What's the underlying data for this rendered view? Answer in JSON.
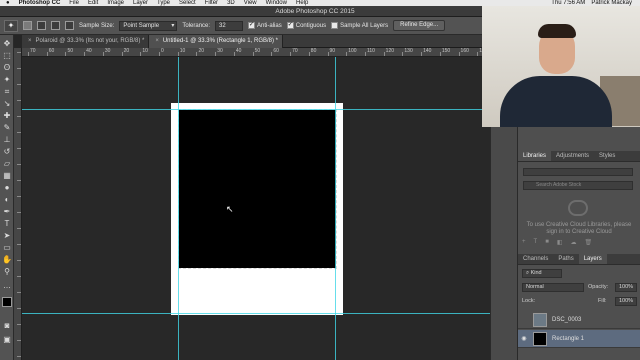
{
  "menubar": {
    "apple": "",
    "app": "Photoshop CC",
    "items": [
      "File",
      "Edit",
      "Image",
      "Layer",
      "Type",
      "Select",
      "Filter",
      "3D",
      "View",
      "Window",
      "Help"
    ],
    "clock": "Thu 7:56 AM",
    "user": "Patrick Mackay"
  },
  "window": {
    "title": "Adobe Photoshop CC 2015"
  },
  "options": {
    "sample_size_label": "Sample Size:",
    "sample_size_value": "Point Sample",
    "tolerance_label": "Tolerance:",
    "tolerance_value": "32",
    "anti_alias": "Anti-alias",
    "contiguous": "Contiguous",
    "sample_all_layers": "Sample All Layers",
    "refine_edge": "Refine Edge..."
  },
  "documents": [
    {
      "title": "Polaroid @ 33.3% (Its not your, RGB/8) *",
      "active": false
    },
    {
      "title": "Untitled-1 @ 33.3% (Rectangle 1, RGB/8) *",
      "active": true
    }
  ],
  "ruler": {
    "ticks": [
      "70",
      "60",
      "50",
      "40",
      "30",
      "20",
      "10",
      "0",
      "10",
      "20",
      "30",
      "40",
      "50",
      "60",
      "70",
      "80",
      "90",
      "100",
      "110",
      "120",
      "130",
      "140",
      "150",
      "160",
      "170"
    ]
  },
  "panels": {
    "top_tabs": [
      "Libraries",
      "Adjustments",
      "Styles"
    ],
    "library_search_placeholder": "Search Adobe Stock",
    "library_message": "To use Creative Cloud Libraries, please sign in to Creative Cloud",
    "layer_tabs": [
      "Channels",
      "Paths",
      "Layers"
    ],
    "kind_filter": "Kind",
    "blend_mode": "Normal",
    "opacity_label": "Opacity:",
    "opacity_value": "100%",
    "lock_label": "Lock:",
    "fill_label": "Fill:",
    "fill_value": "100%",
    "layers": [
      {
        "name": "DSC_0003",
        "selected": false,
        "visible": false
      },
      {
        "name": "Rectangle 1",
        "selected": true,
        "visible": true
      }
    ]
  },
  "colors": {
    "guide": "#40d6e6",
    "panel": "#535353",
    "canvas_bg": "#282828",
    "selection": "#5d6b7f"
  }
}
